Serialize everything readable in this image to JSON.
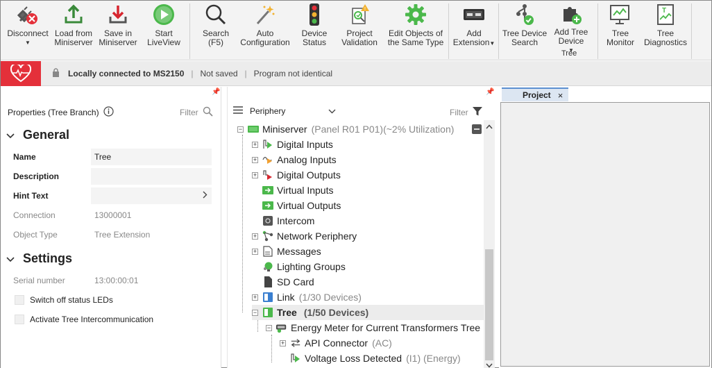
{
  "ribbon": {
    "buttons": [
      {
        "label": "Disconnect",
        "icon": "disconnect-icon"
      },
      {
        "label": "Load from Miniserver",
        "icon": "upload-icon"
      },
      {
        "label": "Save in Miniserver",
        "icon": "download-icon"
      },
      {
        "label": "Start LiveView",
        "icon": "play-icon"
      },
      {
        "label": "Search (F5)",
        "icon": "search-icon"
      },
      {
        "label": "Auto Configuration",
        "icon": "magic-wand-icon"
      },
      {
        "label": "Device Status",
        "icon": "traffic-light-icon"
      },
      {
        "label": "Project Validation",
        "icon": "validation-icon"
      },
      {
        "label": "Edit Objects of the Same Type",
        "icon": "gear-icon"
      },
      {
        "label": "Add Extension",
        "icon": "extension-icon"
      },
      {
        "label": "Tree Device Search",
        "icon": "tree-search-icon"
      },
      {
        "label": "Add Tree Device",
        "icon": "puzzle-add-icon"
      },
      {
        "label": "Tree Monitor",
        "icon": "monitor-icon"
      },
      {
        "label": "Tree Diagnostics",
        "icon": "diagnostics-icon"
      }
    ],
    "group_tree": "Tree"
  },
  "status": {
    "connection": "Locally connected to MS2150",
    "saved": "Not saved",
    "program": "Program not identical"
  },
  "properties": {
    "title": "Properties (Tree Branch)",
    "filter": "Filter",
    "general": "General",
    "name_label": "Name",
    "name_value": "Tree",
    "description_label": "Description",
    "hint_label": "Hint Text",
    "connection_label": "Connection",
    "connection_value": "13000001",
    "object_type_label": "Object Type",
    "object_type_value": "Tree Extension",
    "settings": "Settings",
    "serial_label": "Serial number",
    "serial_value": "13:00:00:01",
    "switch_off_leds": "Switch off status LEDs",
    "activate_intercom": "Activate Tree Intercommunication"
  },
  "periphery": {
    "dropdown": "Periphery",
    "filter": "Filter",
    "miniserver": {
      "label": "Miniserver",
      "detail": "(Panel R01 P01)(~2% Utilization)"
    },
    "items": [
      {
        "label": "Digital Inputs"
      },
      {
        "label": "Analog Inputs"
      },
      {
        "label": "Digital Outputs"
      },
      {
        "label": "Virtual Inputs"
      },
      {
        "label": "Virtual Outputs"
      },
      {
        "label": "Intercom"
      },
      {
        "label": "Network Periphery"
      },
      {
        "label": "Messages"
      },
      {
        "label": "Lighting Groups"
      },
      {
        "label": "SD Card"
      },
      {
        "label": "Link",
        "detail": "(1/30 Devices)"
      },
      {
        "label": "Tree",
        "detail": "(1/50 Devices)"
      }
    ],
    "energy_meter": "Energy Meter for Current Transformers Tree",
    "api_connector": {
      "label": "API Connector",
      "detail": "(AC)"
    },
    "voltage_loss": {
      "label": "Voltage Loss Detected",
      "detail": "(I1) (Energy)"
    }
  },
  "project": {
    "tab_label": "Project",
    "close": "×"
  }
}
